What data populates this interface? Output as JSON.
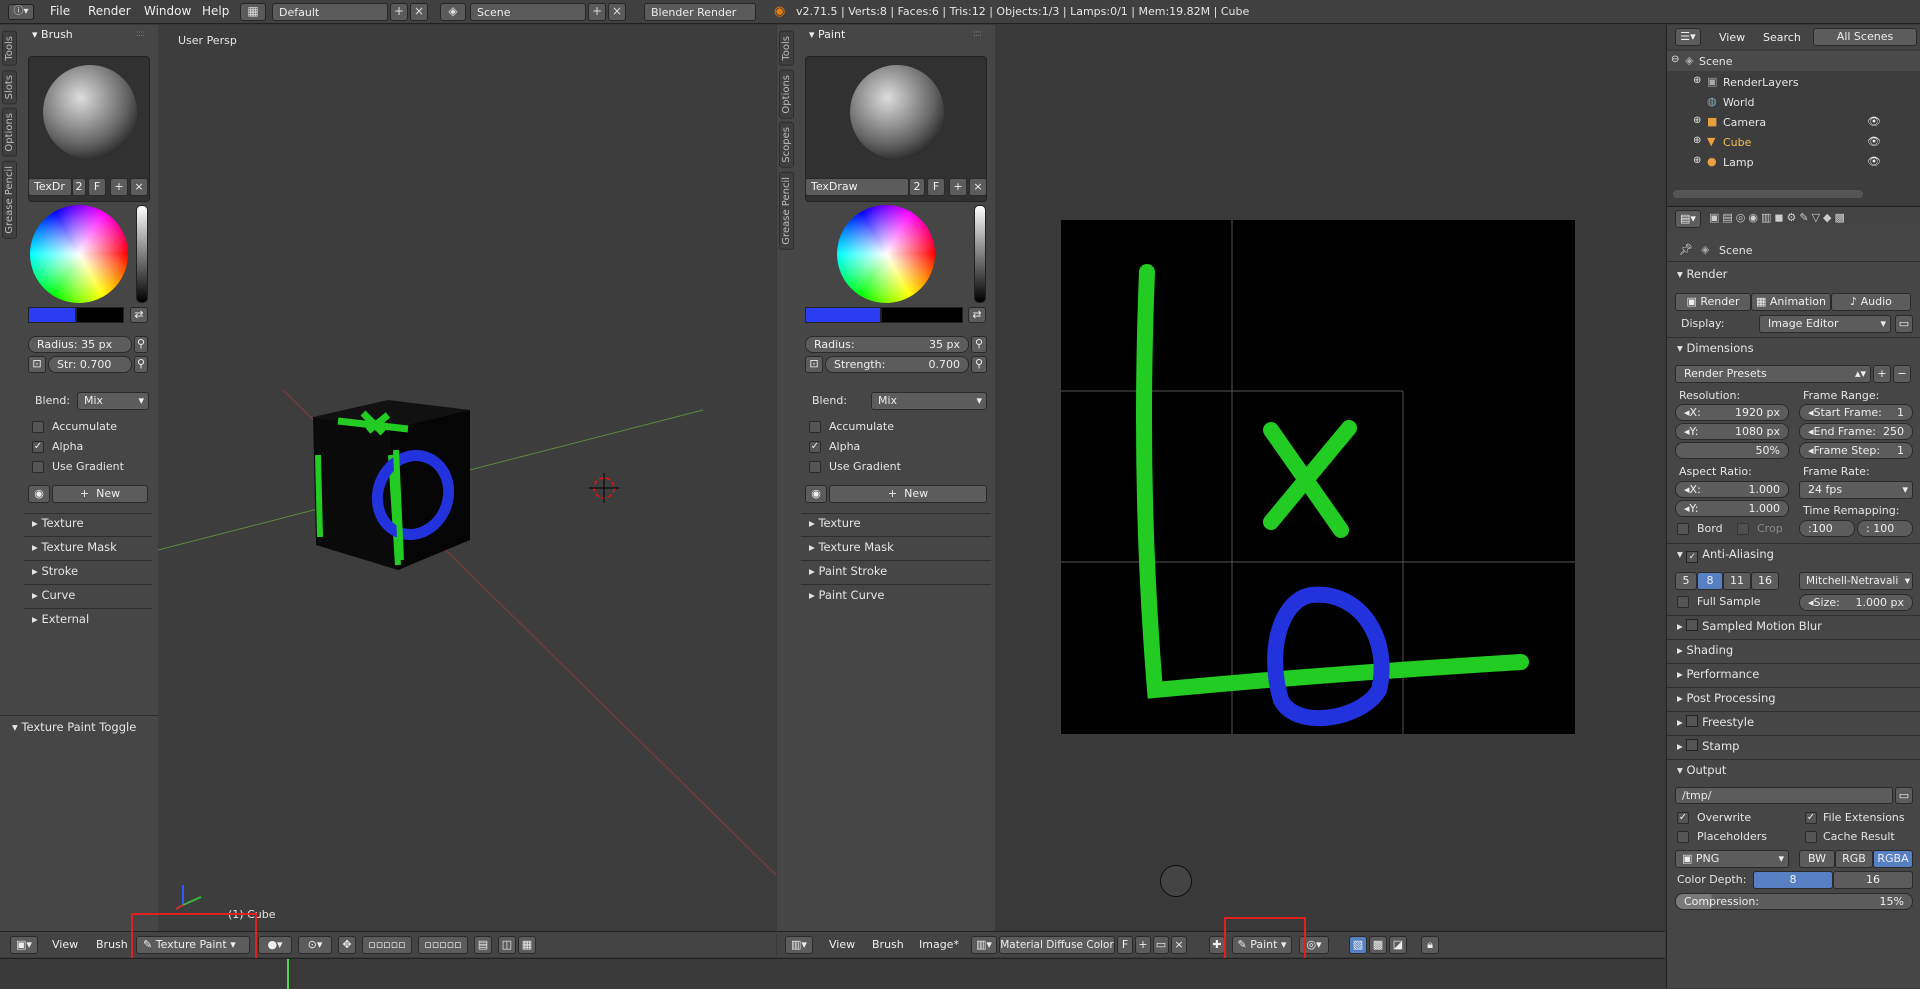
{
  "topbar": {
    "menu": [
      "File",
      "Render",
      "Window",
      "Help"
    ],
    "layout": "Default",
    "scene": "Scene",
    "engine": "Blender Render",
    "stats": "v2.71.5 | Verts:8 | Faces:6 | Tris:12 | Objects:1/3 | Lamps:0/1 | Mem:19.82M | Cube"
  },
  "left_tools": {
    "tabs": [
      "Tools",
      "Slots",
      "Options",
      "Grease Pencil"
    ],
    "panel": "Brush",
    "brush_name": "TexDr",
    "brush_users": "2",
    "fake": "F",
    "radius": "Radius:",
    "radius_val": "35 px",
    "strength": "Str:",
    "strength_val": "0.700",
    "blend_label": "Blend:",
    "blend_val": "Mix",
    "accumulate": "Accumulate",
    "alpha": "Alpha",
    "use_gradient": "Use Gradient",
    "new": "New",
    "sections": [
      "Texture",
      "Texture Mask",
      "Stroke",
      "Curve",
      "External"
    ],
    "toggle": "Texture Paint Toggle"
  },
  "viewport": {
    "label": "User Persp",
    "object": "(1) Cube",
    "menu": [
      "View",
      "Brush"
    ],
    "mode": "Texture Paint"
  },
  "image_tools": {
    "tabs": [
      "Tools",
      "Options",
      "Scopes",
      "Grease Pencil"
    ],
    "panel": "Paint",
    "brush_name": "TexDraw",
    "brush_users": "2",
    "fake": "F",
    "radius": "Radius:",
    "radius_val": "35 px",
    "strength": "Strength:",
    "strength_val": "0.700",
    "blend_label": "Blend:",
    "blend_val": "Mix",
    "accumulate": "Accumulate",
    "alpha": "Alpha",
    "use_gradient": "Use Gradient",
    "new": "New",
    "sections": [
      "Texture",
      "Texture Mask",
      "Paint Stroke",
      "Paint Curve"
    ]
  },
  "image_editor": {
    "menu": [
      "View",
      "Brush",
      "Image*"
    ],
    "image": "Material Diffuse Color",
    "fake": "F",
    "mode": "Paint"
  },
  "outliner": {
    "menu": [
      "View",
      "Search"
    ],
    "filter": "All Scenes",
    "items": [
      "Scene",
      "RenderLayers",
      "World",
      "Camera",
      "Cube",
      "Lamp"
    ]
  },
  "props": {
    "context": "Scene",
    "render": "Render",
    "btn_render": "Render",
    "btn_anim": "Animation",
    "btn_audio": "Audio",
    "display_lbl": "Display:",
    "display_val": "Image Editor",
    "dimensions": "Dimensions",
    "presets": "Render Presets",
    "resolution": "Resolution:",
    "res_x": "X:",
    "res_x_val": "1920 px",
    "res_y": "Y:",
    "res_y_val": "1080 px",
    "res_pct": "50%",
    "frame_range": "Frame Range:",
    "start": "Start Frame:",
    "start_val": "1",
    "end": "End Frame:",
    "end_val": "250",
    "step": "Frame Step:",
    "step_val": "1",
    "aspect": "Aspect Ratio:",
    "asp_x": "X:",
    "asp_x_val": "1.000",
    "asp_y": "Y:",
    "asp_y_val": "1.000",
    "frame_rate": "Frame Rate:",
    "fps": "24 fps",
    "time_remap": "Time Remapping:",
    "remap_old": ":100",
    "remap_new": ": 100",
    "bord": "Bord",
    "crop": "Crop",
    "aa": "Anti-Aliasing",
    "aa_levels": [
      "5",
      "8",
      "11",
      "16"
    ],
    "filter": "Mitchell-Netravali",
    "full_sample": "Full Sample",
    "size": "Size:",
    "size_val": "1.000 px",
    "collapsed": [
      "Sampled Motion Blur",
      "Shading",
      "Performance",
      "Post Processing",
      "Freestyle",
      "Stamp"
    ],
    "output": "Output",
    "path": "/tmp/",
    "overwrite": "Overwrite",
    "file_ext": "File Extensions",
    "placeholders": "Placeholders",
    "cache": "Cache Result",
    "format": "PNG",
    "bw": "BW",
    "rgb": "RGB",
    "rgba": "RGBA",
    "depth_lbl": "Color Depth:",
    "depth8": "8",
    "depth16": "16",
    "compression": "Compression:",
    "compression_val": "15%"
  }
}
